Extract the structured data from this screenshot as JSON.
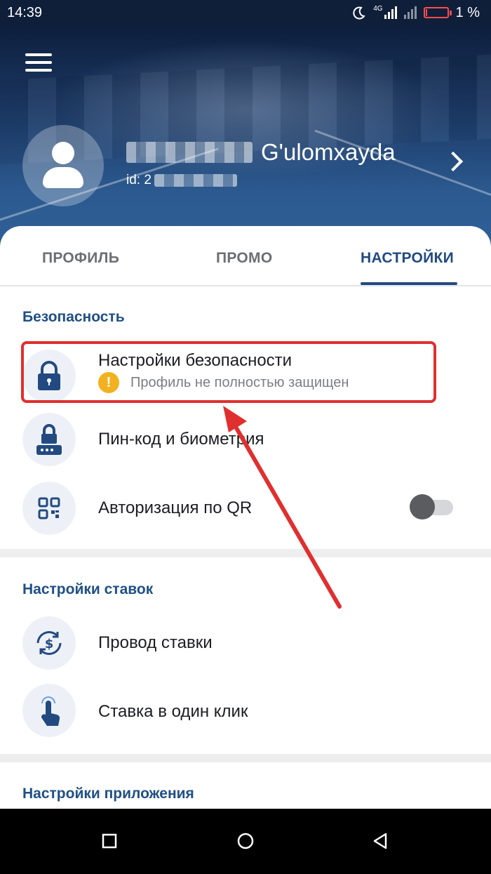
{
  "status_bar": {
    "time": "14:39",
    "network": "4G",
    "battery": "1 %"
  },
  "profile": {
    "name_suffix": "G'ulomxayda",
    "id_prefix": "id: 2"
  },
  "tabs": [
    {
      "label": "ПРОФИЛЬ",
      "active": false
    },
    {
      "label": "ПРОМО",
      "active": false
    },
    {
      "label": "НАСТРОЙКИ",
      "active": true
    }
  ],
  "security_section": {
    "title": "Безопасность",
    "items": [
      {
        "label": "Настройки безопасности",
        "subtitle": "Профиль не полностью защищен",
        "icon": "lock-icon"
      },
      {
        "label": "Пин-код и биометрия",
        "icon": "pin-lock-icon"
      },
      {
        "label": "Авторизация по QR",
        "icon": "qr-icon",
        "toggle": false
      }
    ]
  },
  "bets_section": {
    "title": "Настройки ставок",
    "items": [
      {
        "label": "Провод ставки",
        "icon": "dollar-cycle-icon"
      },
      {
        "label": "Ставка в один клик",
        "icon": "tap-hand-icon"
      }
    ]
  },
  "app_section": {
    "title": "Настройки приложения"
  },
  "colors": {
    "accent": "#224a80",
    "highlight": "#e02f2f",
    "warning": "#f2b11e"
  }
}
